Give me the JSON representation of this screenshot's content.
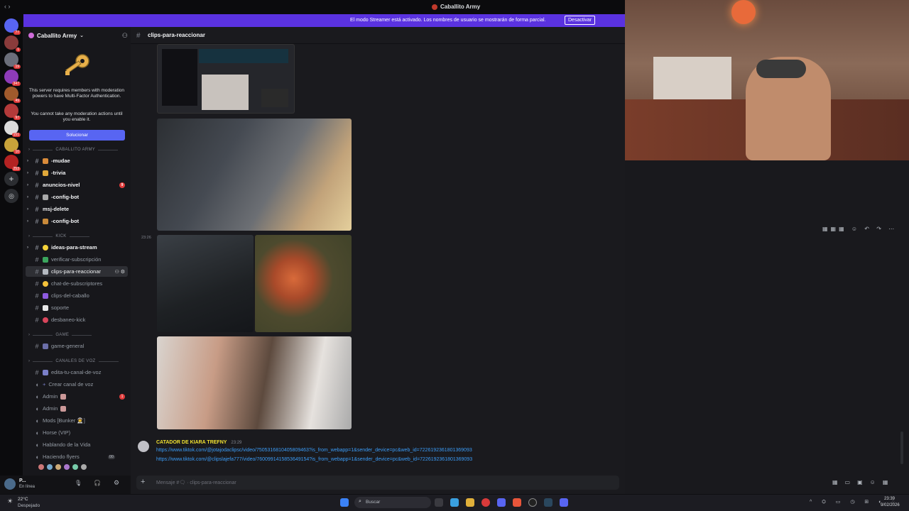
{
  "window": {
    "title": "Caballito Army",
    "nav_glyphs": "‹ ›"
  },
  "banner": {
    "message": "El modo Streamer está activado. Los nombres de usuario se mostrarán de forma parcial.",
    "button": "Desactivar"
  },
  "server_rail": {
    "badges": [
      "77",
      "1",
      "19",
      "347",
      "49",
      "97",
      "151",
      "10",
      "253"
    ]
  },
  "sidebar": {
    "server_name": "Caballito Army",
    "mfa_notice_1": "This server requires members with moderation powers to have Multi-Factor Authentication.",
    "mfa_notice_2": "You cannot take any moderation actions until you enable it.",
    "fix_button": "Solucionar",
    "categories": {
      "caballito": "CABALLITO ARMY",
      "kick": "KICK",
      "game": "GAME",
      "voice": "CANALES DE VOZ"
    },
    "channels_top": [
      {
        "label": "-mudae",
        "badge": ""
      },
      {
        "label": "-trivia",
        "badge": ""
      },
      {
        "label": "anuncios-nivel",
        "badge": "9"
      },
      {
        "label": "-config-bot",
        "badge": ""
      },
      {
        "label": "msj-delete",
        "badge": ""
      },
      {
        "label": "-config-bot",
        "badge": ""
      }
    ],
    "channels_kick": [
      {
        "label": "ideas-para-stream"
      },
      {
        "label": "verificar-subscripción"
      },
      {
        "label": "clips-para-reaccionar"
      },
      {
        "label": "chat-de-subscriptores"
      },
      {
        "label": "clips-del-caballo"
      },
      {
        "label": "soporte"
      },
      {
        "label": "desbaneo-kick"
      }
    ],
    "channels_game": [
      {
        "label": "game-general"
      }
    ],
    "channels_voice": [
      {
        "label": "edita-tu-canal-de-voz"
      },
      {
        "label": "Crear canal de voz"
      },
      {
        "label": "Admin",
        "badge": "1"
      },
      {
        "label": "Admin"
      },
      {
        "label": "Mods [Bunker 👨‍🚀]"
      },
      {
        "label": "Horse (VIP)"
      },
      {
        "label": "Hablando de la Vida"
      },
      {
        "label": "Haciendo flyers",
        "pill": "00"
      }
    ]
  },
  "user_panel": {
    "name": "P...",
    "status": "En línea"
  },
  "channel_header": {
    "name": "clips-para-reaccionar"
  },
  "messages": {
    "timestamp_side": "23:26",
    "author": "CATADOR DE KIARA TREFNY",
    "time": "23:29",
    "link1": "https://www.tiktok.com/@jotajodaclipsc/video/7505316810405809463?is_from_webapp=1&sender_device=pc&web_id=7226192361801369093",
    "link2": "https://www.tiktok.com/@clipslajefa777/video/7600991415853649154?is_from_webapp=1&sender_device=pc&web_id=7226192361801369093"
  },
  "composer": {
    "placeholder": "Mensaje #🗨 · clips-para-reaccionar"
  },
  "taskbar": {
    "weather_temp": "22°C",
    "weather_desc": "Despejado",
    "search": "Buscar",
    "time": "23:39",
    "date": "9/02/2026"
  },
  "colors": {
    "accent": "#5865f2",
    "banner": "#5a32e0",
    "author": "#f0e130",
    "link": "#3b9cf7"
  }
}
